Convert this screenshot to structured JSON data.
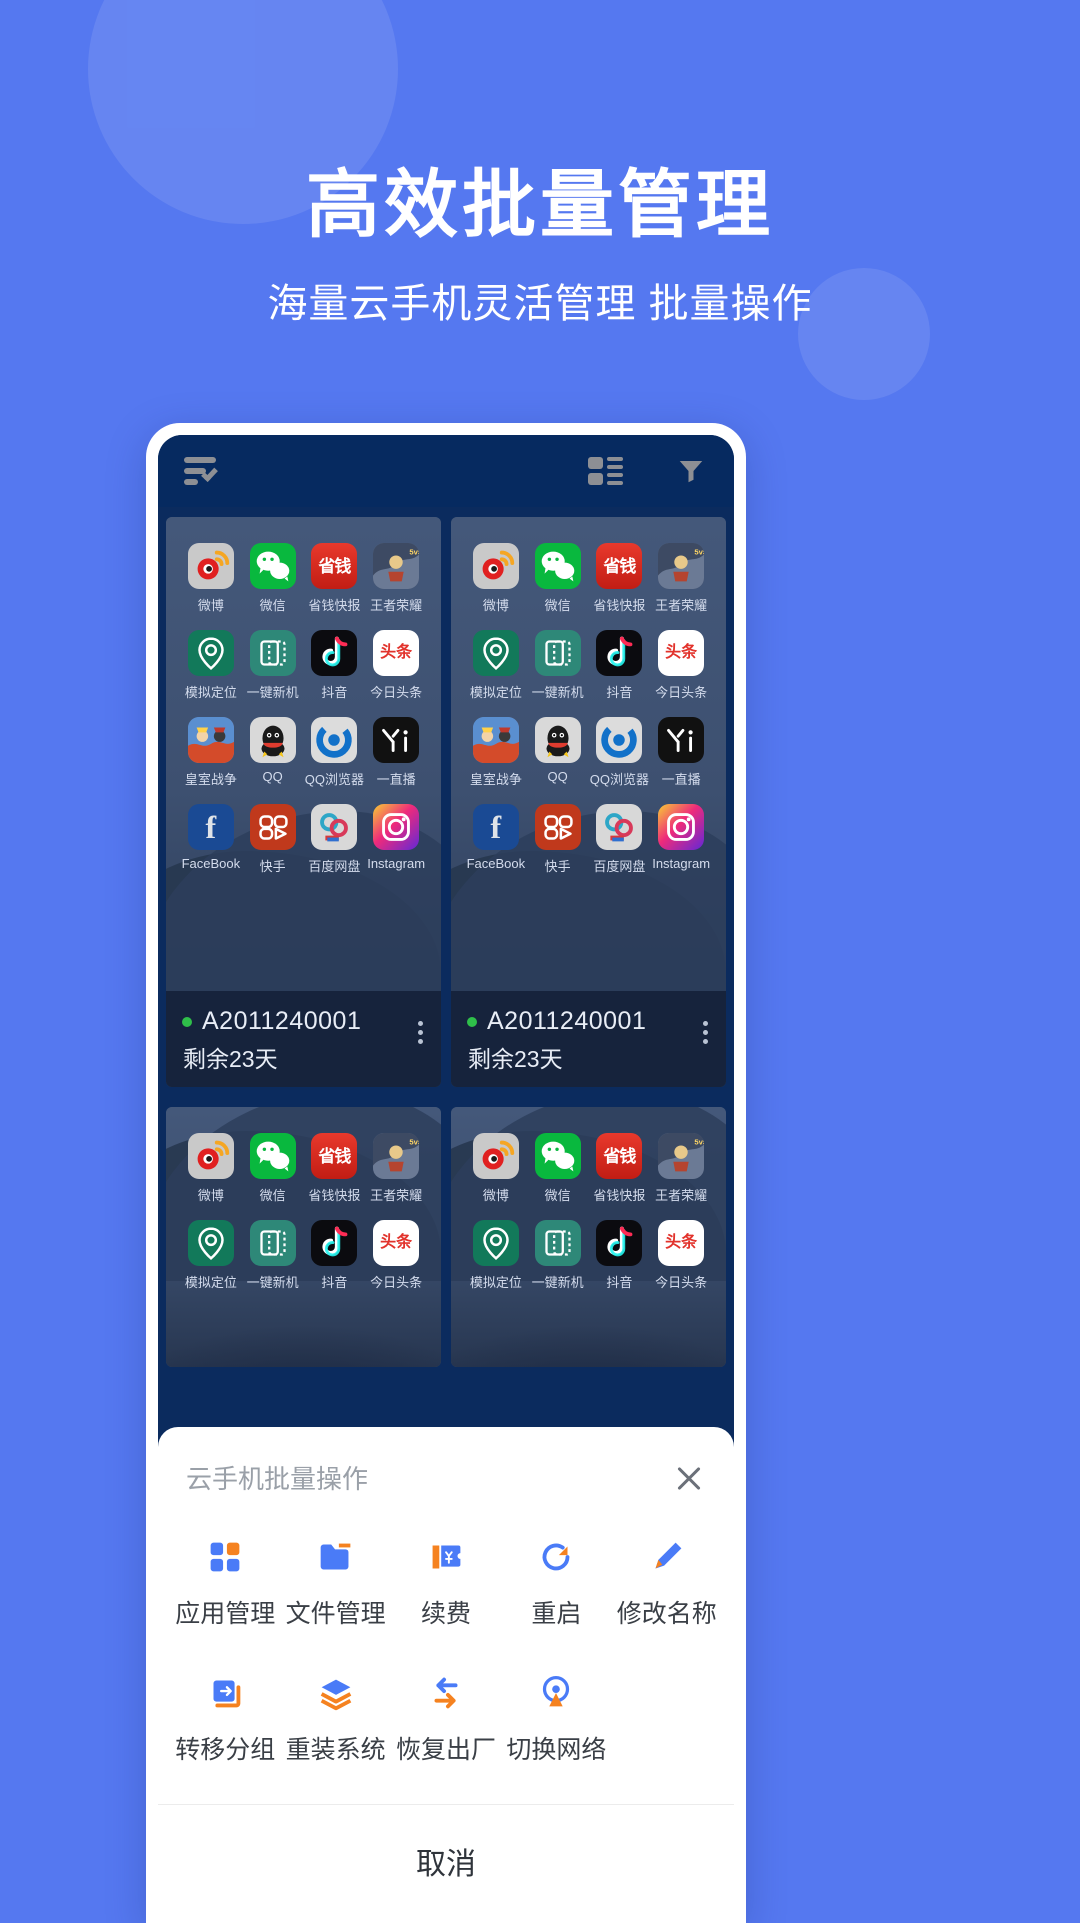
{
  "hero": {
    "title": "高效批量管理",
    "subtitle": "海量云手机灵活管理 批量操作"
  },
  "phone": {
    "topbar": {
      "select_icon": "list-check-icon",
      "view_icon": "grid-list-icon",
      "filter_icon": "funnel-icon"
    },
    "apps": [
      {
        "name": "微博",
        "key": "weibo"
      },
      {
        "name": "微信",
        "key": "wechat"
      },
      {
        "name": "省钱快报",
        "key": "shengqian",
        "glyph": "省钱"
      },
      {
        "name": "王者荣耀",
        "key": "wangzhe"
      },
      {
        "name": "模拟定位",
        "key": "loc"
      },
      {
        "name": "一键新机",
        "key": "newphone"
      },
      {
        "name": "抖音",
        "key": "douyin"
      },
      {
        "name": "今日头条",
        "key": "toutiao",
        "glyph": "头条"
      },
      {
        "name": "皇室战争",
        "key": "huangshi"
      },
      {
        "name": "QQ",
        "key": "qq"
      },
      {
        "name": "QQ浏览器",
        "key": "qqbrow"
      },
      {
        "name": "一直播",
        "key": "yizhibo"
      },
      {
        "name": "FaceBook",
        "key": "facebook",
        "glyph": "f"
      },
      {
        "name": "快手",
        "key": "kuaishou"
      },
      {
        "name": "百度网盘",
        "key": "baidu"
      },
      {
        "name": "Instagram",
        "key": "instagram"
      }
    ],
    "devices": [
      {
        "id": "A2011240001",
        "remaining": "剩余23天",
        "status": "online"
      },
      {
        "id": "A2011240001",
        "remaining": "剩余23天",
        "status": "online"
      }
    ],
    "status_color": "#2fbf4a"
  },
  "sheet": {
    "title": "云手机批量操作",
    "close_icon": "close-icon",
    "actions": [
      {
        "label": "应用管理",
        "icon": "apps-grid-icon"
      },
      {
        "label": "文件管理",
        "icon": "folder-icon"
      },
      {
        "label": "续费",
        "icon": "renew-yen-icon"
      },
      {
        "label": "重启",
        "icon": "restart-icon"
      },
      {
        "label": "修改名称",
        "icon": "pencil-icon"
      },
      {
        "label": "转移分组",
        "icon": "move-group-icon"
      },
      {
        "label": "重装系统",
        "icon": "layers-icon"
      },
      {
        "label": "恢复出厂",
        "icon": "swap-arrows-icon"
      },
      {
        "label": "切换网络",
        "icon": "network-signal-icon"
      }
    ],
    "cancel_label": "取消"
  },
  "theme": {
    "background": "#5578f0",
    "accent_blue": "#4a7bf7",
    "accent_orange": "#f58220"
  }
}
